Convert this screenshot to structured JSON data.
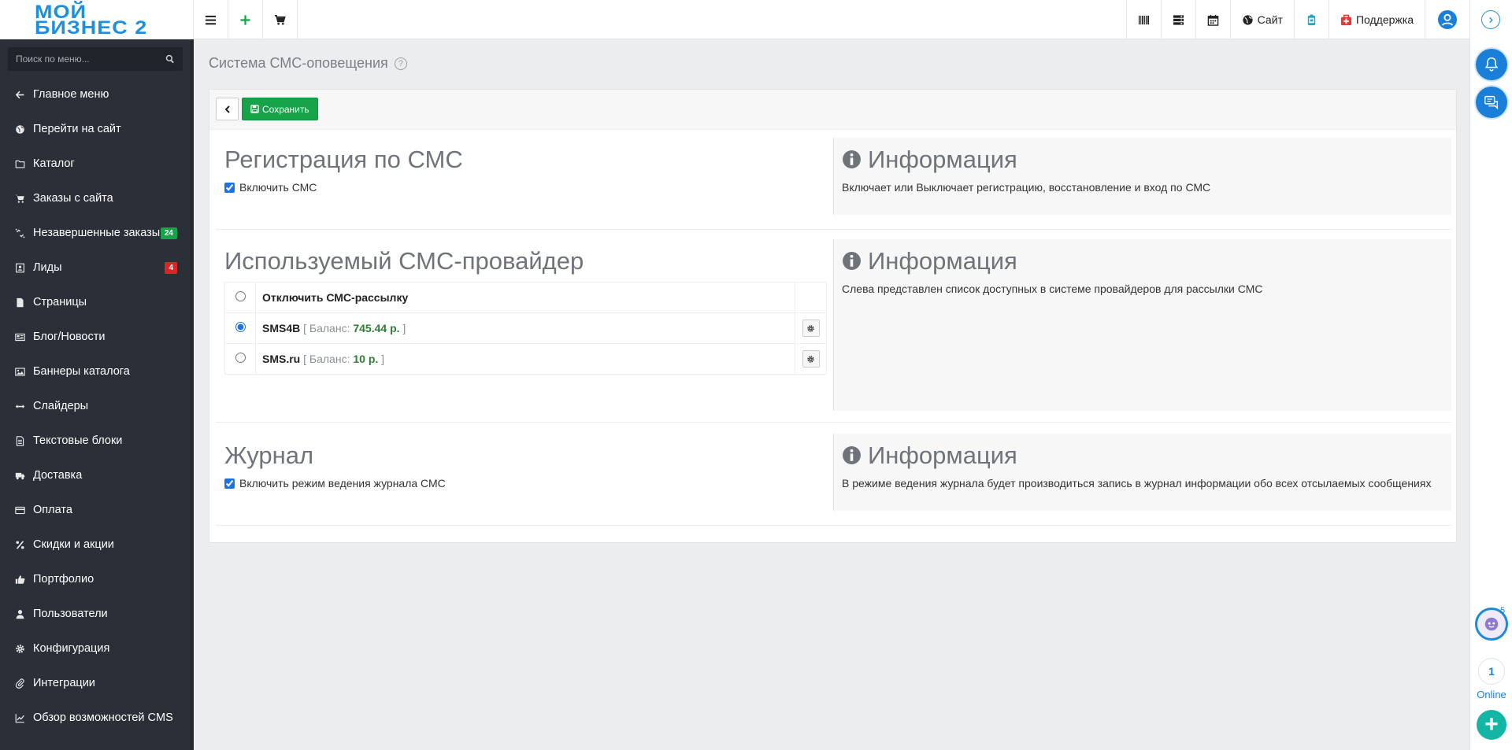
{
  "logo": {
    "line1": "МОЙ",
    "line2": "БИЗНЕС 2"
  },
  "topbar": {
    "site_label": "Сайт",
    "support_label": "Поддержка"
  },
  "sidebar": {
    "search_placeholder": "Поиск по меню...",
    "items": [
      {
        "label": "Главное меню",
        "icon": "arrow-left-icon"
      },
      {
        "label": "Перейти на сайт",
        "icon": "globe-icon"
      },
      {
        "label": "Каталог",
        "icon": "folder-icon"
      },
      {
        "label": "Заказы с сайта",
        "icon": "cart-icon"
      },
      {
        "label": "Незавершенные заказы",
        "icon": "unlink-icon",
        "badge": "24"
      },
      {
        "label": "Лиды",
        "icon": "contact-icon",
        "badge": "4"
      },
      {
        "label": "Страницы",
        "icon": "file-icon"
      },
      {
        "label": "Блог/Новости",
        "icon": "newspaper-icon"
      },
      {
        "label": "Баннеры каталога",
        "icon": "image-icon"
      },
      {
        "label": "Слайдеры",
        "icon": "arrows-h-icon"
      },
      {
        "label": "Текстовые блоки",
        "icon": "text-file-icon"
      },
      {
        "label": "Доставка",
        "icon": "truck-icon"
      },
      {
        "label": "Оплата",
        "icon": "credit-card-icon"
      },
      {
        "label": "Скидки и акции",
        "icon": "percent-icon"
      },
      {
        "label": "Портфолио",
        "icon": "thumbs-up-icon"
      },
      {
        "label": "Пользователи",
        "icon": "user-icon"
      },
      {
        "label": "Конфигурация",
        "icon": "gear-icon"
      },
      {
        "label": "Интеграции",
        "icon": "paperclip-icon"
      },
      {
        "label": "Обзор возможностей CMS",
        "icon": "chart-line-icon"
      }
    ]
  },
  "page": {
    "title": "Система СМС-оповещения",
    "help": "?",
    "save_label": "Сохранить"
  },
  "sections": {
    "registration": {
      "title": "Регистрация по СМС",
      "checkbox_label": "Включить СМС",
      "checked": true,
      "info_title": "Информация",
      "info_text": "Включает или Выключает регистрацию, восстановление и вход по СМС"
    },
    "provider": {
      "title": "Используемый СМС-провайдер",
      "disable_label": "Отключить СМС-рассылку",
      "providers": [
        {
          "name": "SMS4B",
          "balance_prefix": "[ Баланс:",
          "balance": "745.44 р.",
          "balance_suffix": "]",
          "selected": true
        },
        {
          "name": "SMS.ru",
          "balance_prefix": "[ Баланс:",
          "balance": "10 р.",
          "balance_suffix": "]",
          "selected": false
        }
      ],
      "info_title": "Информация",
      "info_text": "Слева представлен список доступных в системе провайдеров для рассылки СМС"
    },
    "journal": {
      "title": "Журнал",
      "checkbox_label": "Включить режим ведения журнала СМС",
      "checked": true,
      "info_title": "Информация",
      "info_text": "В режиме ведения журнала будет производиться запись в журнал информации обо всех отсылаемых сообщениях"
    }
  },
  "rail": {
    "avatar_count": "5",
    "online_count": "1",
    "online_label": "Online",
    "plus": "+"
  },
  "colors": {
    "accent": "#1a7fd8",
    "save": "#16a34a",
    "sidebar": "#2a2f38",
    "badge_red": "#e02424"
  }
}
